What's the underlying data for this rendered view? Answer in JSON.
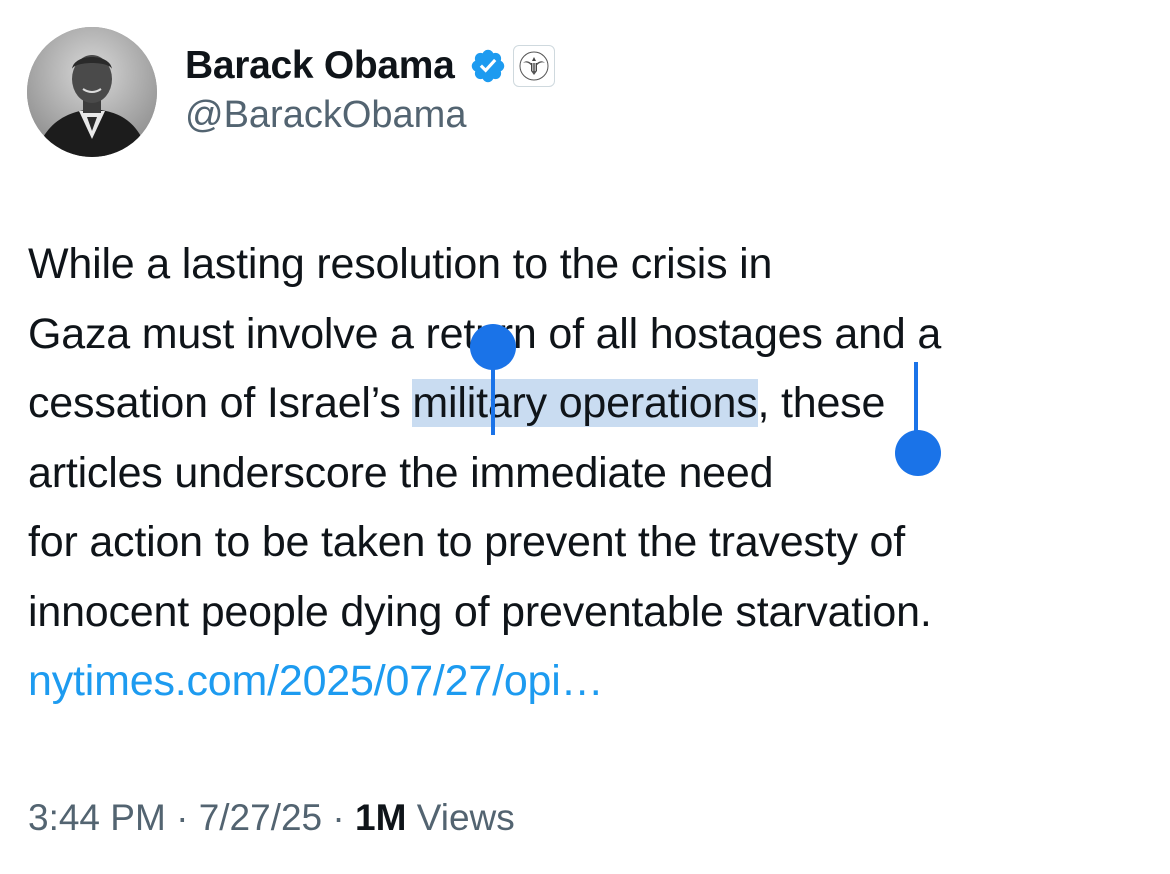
{
  "author": {
    "display_name": "Barack Obama",
    "handle": "@BarackObama",
    "avatar_icon": "portrait-avatar",
    "verified_icon": "verified-badge-icon",
    "affiliate_icon": "government-seal-icon",
    "verified_color": "#1d9bf0"
  },
  "tweet": {
    "lines": [
      "While a lasting resolution to the crisis in",
      "Gaza must involve a return of all hostages and a"
    ],
    "line3_before": "cessation of Israel’s ",
    "line3_selected": "military operations",
    "line3_after": ", these",
    "line4": "articles underscore the immediate need",
    "line5": "for action to be taken to prevent the travesty of",
    "line6": "innocent people dying of preventable starvation.",
    "link": "nytimes.com/2025/07/27/opi…",
    "selection_color": "#c9dcf1",
    "handle_color": "#1a73e8"
  },
  "meta": {
    "time": "3:44 PM",
    "separator": "·",
    "date": "7/27/25",
    "views_count": "1M",
    "views_label": "Views"
  }
}
